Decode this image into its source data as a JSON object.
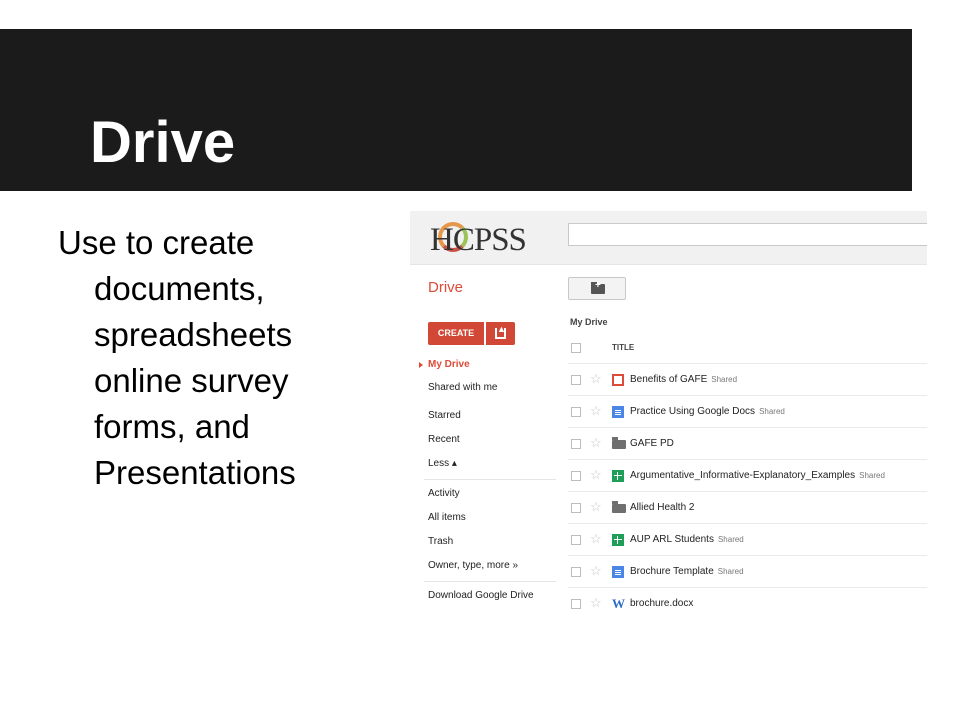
{
  "slide": {
    "title": "Drive",
    "body_lines": [
      "Use to create",
      "documents,",
      "spreadsheets",
      "online survey",
      "forms, and",
      "Presentations"
    ]
  },
  "drive_ui": {
    "logo_text": "HCPSS",
    "app_title": "Drive",
    "create_label": "CREATE",
    "breadcrumb": "My Drive",
    "column_title": "TITLE",
    "sidebar": [
      "My Drive",
      "Shared with me",
      "Starred",
      "Recent",
      "Less ▴",
      "Activity",
      "All items",
      "Trash",
      "Owner, type, more »",
      "Download Google Drive"
    ],
    "files": [
      {
        "name": "Benefits of GAFE",
        "badge": "Shared",
        "icon": "slides-icon"
      },
      {
        "name": "Practice Using Google Docs",
        "badge": "Shared",
        "icon": "doc-icon"
      },
      {
        "name": "GAFE PD",
        "badge": "",
        "icon": "folder-icon"
      },
      {
        "name": "Argumentative_Informative-Explanatory_Examples",
        "badge": "Shared",
        "icon": "sheet-icon"
      },
      {
        "name": "Allied Health 2",
        "badge": "",
        "icon": "folder-icon"
      },
      {
        "name": "AUP ARL Students",
        "badge": "Shared",
        "icon": "sheet-icon"
      },
      {
        "name": "Brochure Template",
        "badge": "Shared",
        "icon": "doc-icon"
      },
      {
        "name": "brochure.docx",
        "badge": "",
        "icon": "word-icon"
      }
    ],
    "colors": {
      "accent_red": "#dd4b39",
      "create_button": "#d14836",
      "doc_blue": "#4a86e8",
      "sheet_green": "#1e9e57",
      "title_band": "#1b1b1b"
    }
  }
}
